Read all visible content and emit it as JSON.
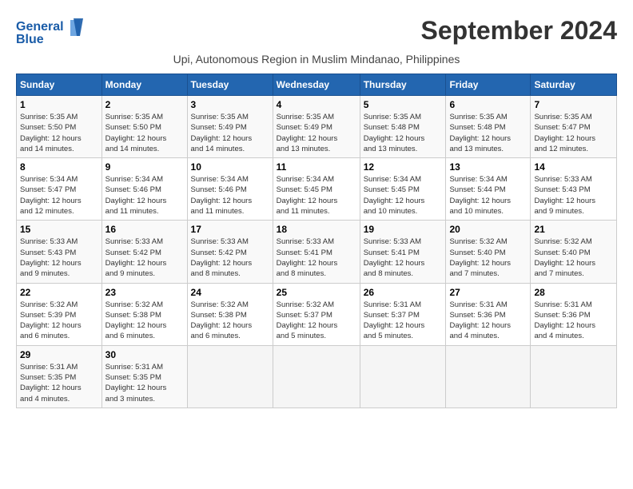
{
  "header": {
    "logo_line1": "General",
    "logo_line2": "Blue",
    "month_title": "September 2024",
    "subtitle": "Upi, Autonomous Region in Muslim Mindanao, Philippines"
  },
  "calendar": {
    "days_of_week": [
      "Sunday",
      "Monday",
      "Tuesday",
      "Wednesday",
      "Thursday",
      "Friday",
      "Saturday"
    ],
    "weeks": [
      [
        {
          "day": "",
          "info": ""
        },
        {
          "day": "2",
          "info": "Sunrise: 5:35 AM\nSunset: 5:50 PM\nDaylight: 12 hours\nand 14 minutes."
        },
        {
          "day": "3",
          "info": "Sunrise: 5:35 AM\nSunset: 5:49 PM\nDaylight: 12 hours\nand 14 minutes."
        },
        {
          "day": "4",
          "info": "Sunrise: 5:35 AM\nSunset: 5:49 PM\nDaylight: 12 hours\nand 13 minutes."
        },
        {
          "day": "5",
          "info": "Sunrise: 5:35 AM\nSunset: 5:48 PM\nDaylight: 12 hours\nand 13 minutes."
        },
        {
          "day": "6",
          "info": "Sunrise: 5:35 AM\nSunset: 5:48 PM\nDaylight: 12 hours\nand 13 minutes."
        },
        {
          "day": "7",
          "info": "Sunrise: 5:35 AM\nSunset: 5:47 PM\nDaylight: 12 hours\nand 12 minutes."
        }
      ],
      [
        {
          "day": "1",
          "info": "Sunrise: 5:35 AM\nSunset: 5:50 PM\nDaylight: 12 hours\nand 14 minutes."
        },
        {
          "day": "9",
          "info": "Sunrise: 5:34 AM\nSunset: 5:46 PM\nDaylight: 12 hours\nand 11 minutes."
        },
        {
          "day": "10",
          "info": "Sunrise: 5:34 AM\nSunset: 5:46 PM\nDaylight: 12 hours\nand 11 minutes."
        },
        {
          "day": "11",
          "info": "Sunrise: 5:34 AM\nSunset: 5:45 PM\nDaylight: 12 hours\nand 11 minutes."
        },
        {
          "day": "12",
          "info": "Sunrise: 5:34 AM\nSunset: 5:45 PM\nDaylight: 12 hours\nand 10 minutes."
        },
        {
          "day": "13",
          "info": "Sunrise: 5:34 AM\nSunset: 5:44 PM\nDaylight: 12 hours\nand 10 minutes."
        },
        {
          "day": "14",
          "info": "Sunrise: 5:33 AM\nSunset: 5:43 PM\nDaylight: 12 hours\nand 9 minutes."
        }
      ],
      [
        {
          "day": "8",
          "info": "Sunrise: 5:34 AM\nSunset: 5:47 PM\nDaylight: 12 hours\nand 12 minutes."
        },
        {
          "day": "16",
          "info": "Sunrise: 5:33 AM\nSunset: 5:42 PM\nDaylight: 12 hours\nand 9 minutes."
        },
        {
          "day": "17",
          "info": "Sunrise: 5:33 AM\nSunset: 5:42 PM\nDaylight: 12 hours\nand 8 minutes."
        },
        {
          "day": "18",
          "info": "Sunrise: 5:33 AM\nSunset: 5:41 PM\nDaylight: 12 hours\nand 8 minutes."
        },
        {
          "day": "19",
          "info": "Sunrise: 5:33 AM\nSunset: 5:41 PM\nDaylight: 12 hours\nand 8 minutes."
        },
        {
          "day": "20",
          "info": "Sunrise: 5:32 AM\nSunset: 5:40 PM\nDaylight: 12 hours\nand 7 minutes."
        },
        {
          "day": "21",
          "info": "Sunrise: 5:32 AM\nSunset: 5:40 PM\nDaylight: 12 hours\nand 7 minutes."
        }
      ],
      [
        {
          "day": "15",
          "info": "Sunrise: 5:33 AM\nSunset: 5:43 PM\nDaylight: 12 hours\nand 9 minutes."
        },
        {
          "day": "23",
          "info": "Sunrise: 5:32 AM\nSunset: 5:38 PM\nDaylight: 12 hours\nand 6 minutes."
        },
        {
          "day": "24",
          "info": "Sunrise: 5:32 AM\nSunset: 5:38 PM\nDaylight: 12 hours\nand 6 minutes."
        },
        {
          "day": "25",
          "info": "Sunrise: 5:32 AM\nSunset: 5:37 PM\nDaylight: 12 hours\nand 5 minutes."
        },
        {
          "day": "26",
          "info": "Sunrise: 5:31 AM\nSunset: 5:37 PM\nDaylight: 12 hours\nand 5 minutes."
        },
        {
          "day": "27",
          "info": "Sunrise: 5:31 AM\nSunset: 5:36 PM\nDaylight: 12 hours\nand 4 minutes."
        },
        {
          "day": "28",
          "info": "Sunrise: 5:31 AM\nSunset: 5:36 PM\nDaylight: 12 hours\nand 4 minutes."
        }
      ],
      [
        {
          "day": "22",
          "info": "Sunrise: 5:32 AM\nSunset: 5:39 PM\nDaylight: 12 hours\nand 6 minutes."
        },
        {
          "day": "30",
          "info": "Sunrise: 5:31 AM\nSunset: 5:35 PM\nDaylight: 12 hours\nand 3 minutes."
        },
        {
          "day": "",
          "info": ""
        },
        {
          "day": "",
          "info": ""
        },
        {
          "day": "",
          "info": ""
        },
        {
          "day": "",
          "info": ""
        },
        {
          "day": "",
          "info": ""
        }
      ],
      [
        {
          "day": "29",
          "info": "Sunrise: 5:31 AM\nSunset: 5:35 PM\nDaylight: 12 hours\nand 4 minutes."
        },
        {
          "day": "",
          "info": ""
        },
        {
          "day": "",
          "info": ""
        },
        {
          "day": "",
          "info": ""
        },
        {
          "day": "",
          "info": ""
        },
        {
          "day": "",
          "info": ""
        },
        {
          "day": "",
          "info": ""
        }
      ]
    ]
  }
}
